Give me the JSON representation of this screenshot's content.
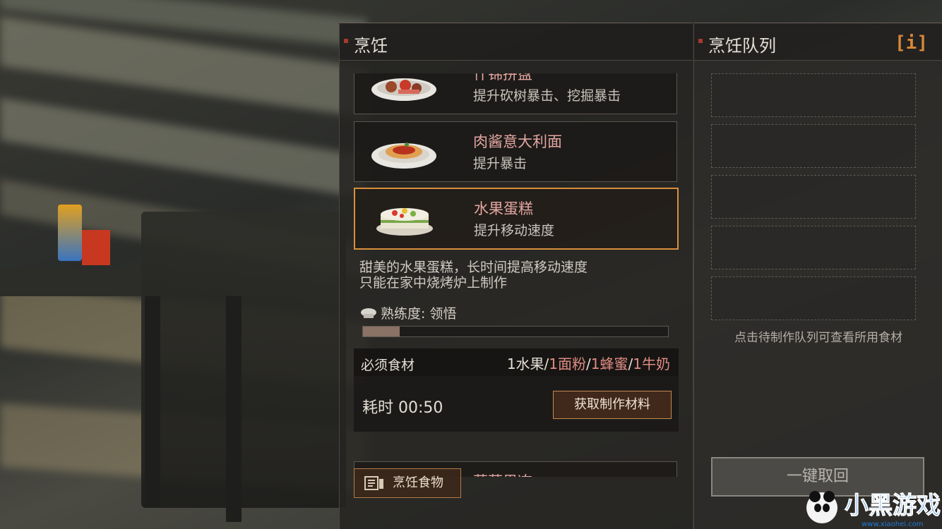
{
  "cooking": {
    "title": "烹饪",
    "recipes": [
      {
        "name": "什锦拼盘",
        "desc": "提升砍树暴击、挖掘暴击"
      },
      {
        "name": "肉酱意大利面",
        "desc": "提升暴击"
      },
      {
        "name": "水果蛋糕",
        "desc": "提升移动速度",
        "selected": true
      },
      {
        "name": "草莓果冻",
        "desc": ""
      }
    ],
    "detail": {
      "desc_line1": "甜美的水果蛋糕，长时间提高移动速度",
      "desc_line2": "只能在家中烧烤炉上制作",
      "proficiency": "熟练度: 领悟",
      "proficiency_progress": 0.12,
      "ingredients_label": "必须食材",
      "ingredients": [
        {
          "text": "1水果",
          "missing": false
        },
        {
          "text": "/",
          "missing": false
        },
        {
          "text": "1面粉",
          "missing": true
        },
        {
          "text": "/",
          "missing": false
        },
        {
          "text": "1蜂蜜",
          "missing": true
        },
        {
          "text": "/",
          "missing": false
        },
        {
          "text": "1牛奶",
          "missing": true
        }
      ],
      "time": "耗时 00:50",
      "get_materials_label": "获取制作材料"
    },
    "cook_food_label": "烹饪食物",
    "colors": {
      "accent": "#d8903c",
      "missing": "#e08c84"
    }
  },
  "queue": {
    "title": "烹饪队列",
    "info_icon": "i",
    "hint": "点击待制作队列可查看所用食材",
    "cancel_all_label": "一键取回",
    "slots": 5
  },
  "watermark": {
    "text": "小黑游戏",
    "url": "www.xiaohei.com"
  }
}
